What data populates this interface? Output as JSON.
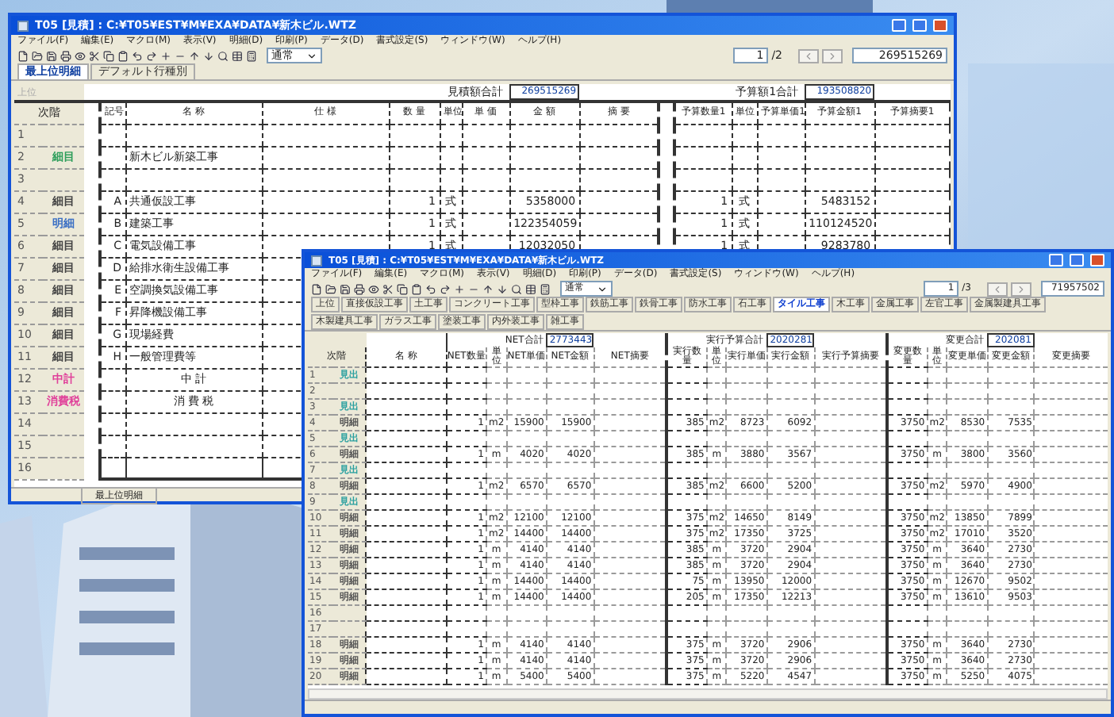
{
  "window_1": {
    "title": "T05 [見積] : C:¥T05¥EST¥M¥EXA¥DATA¥新木ビル.WTZ",
    "menu": [
      "ファイル(F)",
      "編集(E)",
      "マクロ(M)",
      "表示(V)",
      "明細(D)",
      "印刷(P)",
      "データ(D)",
      "書式設定(S)",
      "ウィンドウ(W)",
      "ヘルプ(H)"
    ],
    "view_select": "通常",
    "page_field": "1",
    "page_total": "/2",
    "grand_total": "269515269",
    "tabs": [
      {
        "label": "最上位明細",
        "selected": true
      },
      {
        "label": "デフォルト行種別",
        "selected": false
      }
    ],
    "up_button": "上位",
    "level_header": "次階",
    "estimate_total_label": "見積額合計",
    "estimate_total": "269515269",
    "budget_total_label": "予算額1合計",
    "budget_total": "193508820",
    "columns": [
      "記号",
      "名 称",
      "仕 様",
      "数 量",
      "単位",
      "単 価",
      "金 額",
      "摘 要"
    ],
    "budget_columns": [
      "予算数量1",
      "単位",
      "予算単価1",
      "予算金額1",
      "予算摘要1"
    ],
    "rows": [
      {
        "number": "1",
        "kind": "item"
      },
      {
        "number": "2",
        "kind": "item",
        "label": "細目",
        "color": "#2e9e5b",
        "name": "新木ビル新築工事"
      },
      {
        "number": "3",
        "kind": "item"
      },
      {
        "number": "4",
        "kind": "item",
        "label": "細目",
        "color": "#444444",
        "code": "A",
        "name": "共通仮設工事",
        "qty": "1",
        "unit": "式",
        "amount": "5358000",
        "budget_qty": "1",
        "budget_unit": "式",
        "budget_amount": "5483152"
      },
      {
        "number": "5",
        "kind": "item",
        "label": "明細",
        "color": "#3a6fc4",
        "code": "B",
        "name": "建築工事",
        "qty": "1",
        "unit": "式",
        "amount": "122354059",
        "budget_qty": "1",
        "budget_unit": "式",
        "budget_amount": "110124520"
      },
      {
        "number": "6",
        "kind": "item",
        "label": "細目",
        "color": "#444444",
        "code": "C",
        "name": "電気設備工事",
        "qty": "1",
        "unit": "式",
        "amount": "12032050",
        "budget_qty": "1",
        "budget_unit": "式",
        "budget_amount": "9283780"
      },
      {
        "number": "7",
        "kind": "item",
        "label": "細目",
        "color": "#444444",
        "code": "D",
        "name": "給排水衛生設備工事"
      },
      {
        "number": "8",
        "kind": "item",
        "label": "細目",
        "color": "#444444",
        "code": "E",
        "name": "空調換気設備工事"
      },
      {
        "number": "9",
        "kind": "item",
        "label": "細目",
        "color": "#444444",
        "code": "F",
        "name": "昇降機設備工事"
      },
      {
        "number": "10",
        "kind": "item",
        "label": "細目",
        "color": "#444444",
        "code": "G",
        "name": "現場経費"
      },
      {
        "number": "11",
        "kind": "item",
        "label": "細目",
        "color": "#444444",
        "code": "H",
        "name": "一般管理費等"
      },
      {
        "number": "12",
        "kind": "total",
        "label": "中計",
        "color": "#e0409a",
        "name": "中 計"
      },
      {
        "number": "13",
        "kind": "total",
        "label": "消費税",
        "color": "#e0409a",
        "name": "消 費 税"
      },
      {
        "number": "14",
        "kind": "item"
      },
      {
        "number": "15",
        "kind": "item"
      },
      {
        "number": "16",
        "kind": "item"
      }
    ],
    "status": "最上位明細"
  },
  "window_2": {
    "title": "T05 [見積] : C:¥T05¥EST¥M¥EXA¥DATA¥新木ビル.WTZ",
    "menu": [
      "ファイル(F)",
      "編集(E)",
      "マクロ(M)",
      "表示(V)",
      "明細(D)",
      "印刷(P)",
      "データ(D)",
      "書式設定(S)",
      "ウィンドウ(W)",
      "ヘルプ(H)"
    ],
    "view_select": "通常",
    "page_field": "1",
    "page_total": "/3",
    "grand_total": "71957502",
    "tabs": [
      {
        "label": "上位",
        "selected": false
      },
      {
        "label": "直接仮設工事",
        "selected": false
      },
      {
        "label": "土工事",
        "selected": false
      },
      {
        "label": "コンクリート工事",
        "selected": false
      },
      {
        "label": "型枠工事",
        "selected": false
      },
      {
        "label": "鉄筋工事",
        "selected": false
      },
      {
        "label": "鉄骨工事",
        "selected": false
      },
      {
        "label": "防水工事",
        "selected": false
      },
      {
        "label": "石工事",
        "selected": false
      },
      {
        "label": "タイル工事",
        "selected": true
      },
      {
        "label": "木工事",
        "selected": false
      },
      {
        "label": "金属工事",
        "selected": false
      },
      {
        "label": "左官工事",
        "selected": false
      },
      {
        "label": "金属製建具工事",
        "selected": false
      },
      {
        "label": "木製建具工事",
        "selected": false
      },
      {
        "label": "ガラス工事",
        "selected": false
      },
      {
        "label": "塗装工事",
        "selected": false
      },
      {
        "label": "内外装工事",
        "selected": false
      },
      {
        "label": "雑工事",
        "selected": false
      }
    ],
    "level_header": "次階",
    "name_column": "名 称",
    "groups": [
      {
        "total_label": "NET合計",
        "total": "2773443",
        "columns": [
          "NET数量",
          "単位",
          "NET単価",
          "NET金額",
          "NET摘要"
        ]
      },
      {
        "total_label": "実行予算合計",
        "total": "2020281",
        "columns": [
          "実行数量",
          "単位",
          "実行単価",
          "実行金額",
          "実行予算摘要"
        ]
      },
      {
        "total_label": "変更合計",
        "total": "202081",
        "columns": [
          "変更数量",
          "単位",
          "変更単価",
          "変更金額",
          "変更摘要"
        ]
      }
    ],
    "rows": [
      {
        "number": "1",
        "label": "見出",
        "color": "#2aa0a0"
      },
      {
        "number": "2"
      },
      {
        "number": "3",
        "label": "見出",
        "color": "#2aa0a0"
      },
      {
        "number": "4",
        "label": "明細",
        "color": "#555555",
        "values": [
          [
            "1",
            "m2",
            "15900",
            "15900"
          ],
          [
            "385",
            "m2",
            "8723",
            "6092"
          ],
          [
            "3750",
            "m2",
            "8530",
            "7535"
          ]
        ]
      },
      {
        "number": "5",
        "label": "見出",
        "color": "#2aa0a0"
      },
      {
        "number": "6",
        "label": "明細",
        "color": "#555555",
        "values": [
          [
            "1",
            "m",
            "4020",
            "4020"
          ],
          [
            "385",
            "m",
            "3880",
            "3567"
          ],
          [
            "3750",
            "m",
            "3800",
            "3560"
          ]
        ]
      },
      {
        "number": "7",
        "label": "見出",
        "color": "#2aa0a0"
      },
      {
        "number": "8",
        "label": "明細",
        "color": "#555555",
        "values": [
          [
            "1",
            "m2",
            "6570",
            "6570"
          ],
          [
            "385",
            "m2",
            "6600",
            "5200"
          ],
          [
            "3750",
            "m2",
            "5970",
            "4900"
          ]
        ]
      },
      {
        "number": "9",
        "label": "見出",
        "color": "#2aa0a0"
      },
      {
        "number": "10",
        "label": "明細",
        "color": "#555555",
        "values": [
          [
            "1",
            "m2",
            "12100",
            "12100"
          ],
          [
            "375",
            "m2",
            "14650",
            "8149"
          ],
          [
            "3750",
            "m2",
            "13850",
            "7899"
          ]
        ]
      },
      {
        "number": "11",
        "label": "明細",
        "color": "#555555",
        "values": [
          [
            "1",
            "m2",
            "14400",
            "14400"
          ],
          [
            "375",
            "m2",
            "17350",
            "3725"
          ],
          [
            "3750",
            "m2",
            "17010",
            "3520"
          ]
        ]
      },
      {
        "number": "12",
        "label": "明細",
        "color": "#555555",
        "values": [
          [
            "1",
            "m",
            "4140",
            "4140"
          ],
          [
            "385",
            "m",
            "3720",
            "2904"
          ],
          [
            "3750",
            "m",
            "3640",
            "2730"
          ]
        ]
      },
      {
        "number": "13",
        "label": "明細",
        "color": "#555555",
        "values": [
          [
            "1",
            "m",
            "4140",
            "4140"
          ],
          [
            "385",
            "m",
            "3720",
            "2904"
          ],
          [
            "3750",
            "m",
            "3640",
            "2730"
          ]
        ]
      },
      {
        "number": "14",
        "label": "明細",
        "color": "#555555",
        "values": [
          [
            "1",
            "m",
            "14400",
            "14400"
          ],
          [
            "75",
            "m",
            "13950",
            "12000"
          ],
          [
            "3750",
            "m",
            "12670",
            "9502"
          ]
        ]
      },
      {
        "number": "15",
        "label": "明細",
        "color": "#555555",
        "values": [
          [
            "1",
            "m",
            "14400",
            "14400"
          ],
          [
            "205",
            "m",
            "17350",
            "12213"
          ],
          [
            "3750",
            "m",
            "13610",
            "9503"
          ]
        ]
      },
      {
        "number": "16"
      },
      {
        "number": "17"
      },
      {
        "number": "18",
        "label": "明細",
        "color": "#555555",
        "values": [
          [
            "1",
            "m",
            "4140",
            "4140"
          ],
          [
            "375",
            "m",
            "3720",
            "2906"
          ],
          [
            "3750",
            "m",
            "3640",
            "2730"
          ]
        ]
      },
      {
        "number": "19",
        "label": "明細",
        "color": "#555555",
        "values": [
          [
            "1",
            "m",
            "4140",
            "4140"
          ],
          [
            "375",
            "m",
            "3720",
            "2906"
          ],
          [
            "3750",
            "m",
            "3640",
            "2730"
          ]
        ]
      },
      {
        "number": "20",
        "label": "明細",
        "color": "#555555",
        "values": [
          [
            "1",
            "m",
            "5400",
            "5400"
          ],
          [
            "375",
            "m",
            "5220",
            "4547"
          ],
          [
            "3750",
            "m",
            "5250",
            "4075"
          ]
        ]
      }
    ]
  }
}
